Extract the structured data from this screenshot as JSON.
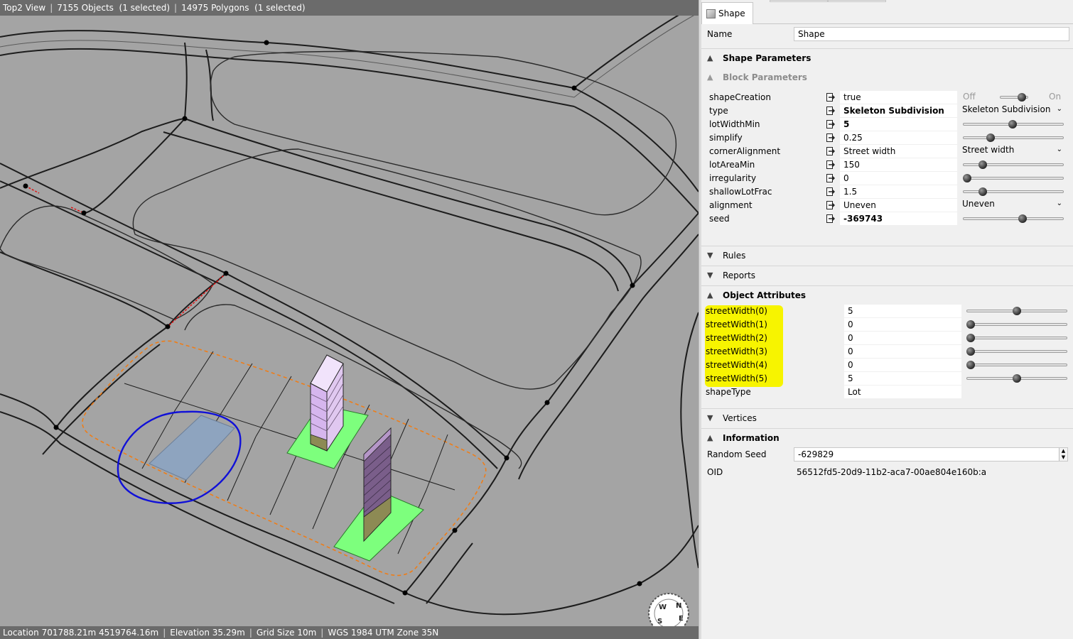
{
  "viewport": {
    "header": {
      "view_name": "Top2 View",
      "objects": "7155 Objects  (1 selected)",
      "polygons": "14975 Polygons  (1 selected)"
    },
    "footer": {
      "location": "Location 701788.21m 4519764.16m",
      "elevation": "Elevation 35.29m",
      "grid": "Grid Size 10m",
      "crs": "WGS 1984 UTM Zone 35N"
    },
    "compass": [
      "N",
      "E",
      "S",
      "W"
    ]
  },
  "inspector": {
    "tab_label": "Shape",
    "name_label": "Name",
    "name_value": "Shape",
    "shape_parameters": "Shape Parameters",
    "block_parameters": "Block Parameters",
    "params": [
      {
        "name": "shapeCreation",
        "value": "true",
        "bold": false,
        "control": "toggle",
        "off": "Off",
        "on": "On",
        "level": 0.9
      },
      {
        "name": "type",
        "value": "Skeleton Subdivision",
        "bold": true,
        "control": "combo",
        "combo": "Skeleton Subdivision"
      },
      {
        "name": "lotWidthMin",
        "value": "5",
        "bold": true,
        "control": "slider",
        "level": 0.49
      },
      {
        "name": "simplify",
        "value": "0.25",
        "bold": false,
        "control": "slider",
        "level": 0.25
      },
      {
        "name": "cornerAlignment",
        "value": "Street width",
        "bold": false,
        "control": "combo",
        "combo": "Street width"
      },
      {
        "name": "lotAreaMin",
        "value": "150",
        "bold": false,
        "control": "slider",
        "level": 0.17
      },
      {
        "name": "irregularity",
        "value": "0",
        "bold": false,
        "control": "slider",
        "level": 0.0
      },
      {
        "name": "shallowLotFrac",
        "value": "1.5",
        "bold": false,
        "control": "slider",
        "level": 0.17
      },
      {
        "name": "alignment",
        "value": "Uneven",
        "bold": false,
        "control": "combo",
        "combo": "Uneven"
      },
      {
        "name": "seed",
        "value": "-369743",
        "bold": true,
        "control": "slider",
        "level": 0.6
      }
    ],
    "rules": "Rules",
    "reports": "Reports",
    "object_attributes": "Object Attributes",
    "attributes": [
      {
        "name": "streetWidth(0)",
        "value": "5",
        "level": 0.5
      },
      {
        "name": "streetWidth(1)",
        "value": "0",
        "level": 0.0
      },
      {
        "name": "streetWidth(2)",
        "value": "0",
        "level": 0.0
      },
      {
        "name": "streetWidth(3)",
        "value": "0",
        "level": 0.0
      },
      {
        "name": "streetWidth(4)",
        "value": "0",
        "level": 0.0
      },
      {
        "name": "streetWidth(5)",
        "value": "5",
        "level": 0.5
      },
      {
        "name": "shapeType",
        "value": "Lot",
        "level": null
      }
    ],
    "vertices": "Vertices",
    "information": "Information",
    "random_seed_label": "Random Seed",
    "random_seed_value": "-629829",
    "oid_label": "OID",
    "oid_value": "56512fd5-20d9-11b2-aca7-00ae804e160b:a"
  }
}
